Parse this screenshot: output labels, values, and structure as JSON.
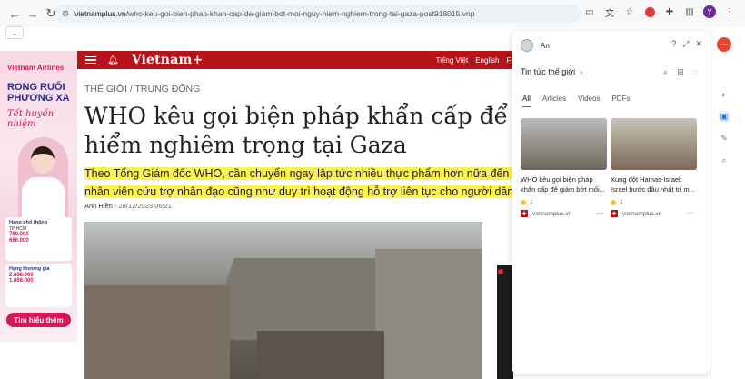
{
  "browser": {
    "url_host": "vietnamplus.vn",
    "url_path": "/who-keu-goi-bien-phap-khan-cap-de-giam-bot-moi-nguy-hiem-nghiem-trong-tai-gaza-post918015.vnp",
    "profile_initial": "Y"
  },
  "ad": {
    "brand": "Vietnam Airlines",
    "headline": "RONG RUỔI PHƯƠNG XA",
    "script": "Tết huyền nhiệm",
    "card1_title": "Hạng phổ thông",
    "card1_from": "TP HCM",
    "card1_price1": "789.000",
    "card1_price2": "666.000",
    "card2_title": "Hạng thương gia",
    "card2_price1": "2.888.000",
    "card2_price2": "1.868.000",
    "button": "Tìm hiểu thêm",
    "note": "Giá (chưa thuế, phí)"
  },
  "site": {
    "logo": "Vietnam+",
    "languages": [
      "Tiếng Việt",
      "English",
      "Fr"
    ]
  },
  "article": {
    "breadcrumb": "THẾ GIỚI / TRUNG ĐÔNG",
    "headline_line1": "WHO kêu gọi biện pháp khẩn cấp để giảm b",
    "headline_line2": "hiểm nghiêm trọng tại Gaza",
    "sapo_line1": "Theo Tổng Giám đốc WHO, cần chuyển ngay lập tức nhiều thực phẩm hơn nữa đến Dải Gaza để c",
    "sapo_line2": "nhân viên cứu trợ nhân đạo cũng như duy trì hoạt động hỗ trợ liên tục cho người dân.",
    "author": "Anh Hiền",
    "date": "28/12/2023 06:21"
  },
  "panel": {
    "user": "An",
    "feed": "Tin tức thế giới",
    "tabs": [
      "All",
      "Articles",
      "Videos",
      "PDFs"
    ],
    "active_tab": "All",
    "cards": [
      {
        "title": "WHO kêu gọi biện pháp khẩn cấp để giảm bớt mối...",
        "count": "1",
        "source": "vietnamplus.vn"
      },
      {
        "title": "Xung đột Hamas-Israel: Israel bước đầu nhất trí m...",
        "count": "1",
        "source": "vietnamplus.vn"
      }
    ]
  }
}
